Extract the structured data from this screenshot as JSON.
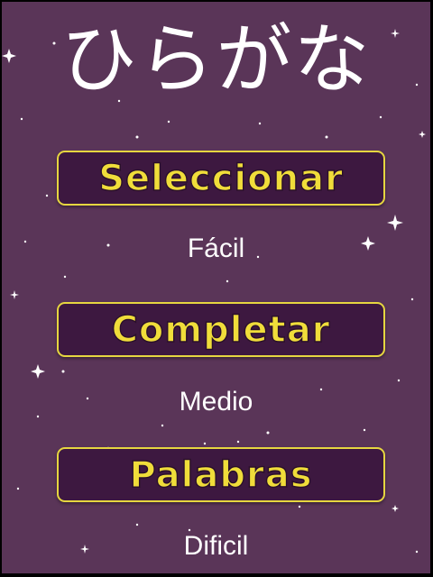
{
  "title": "ひらがな",
  "menu": {
    "items": [
      {
        "label": "Seleccionar",
        "difficulty": "Fácil"
      },
      {
        "label": "Completar",
        "difficulty": "Medio"
      },
      {
        "label": "Palabras",
        "difficulty": "Dificil"
      }
    ]
  },
  "colors": {
    "background": "#5a3558",
    "button_fill": "#3d1840",
    "button_border": "#e6d640",
    "button_text": "#f0dd3a",
    "title_text": "#ffffff"
  }
}
